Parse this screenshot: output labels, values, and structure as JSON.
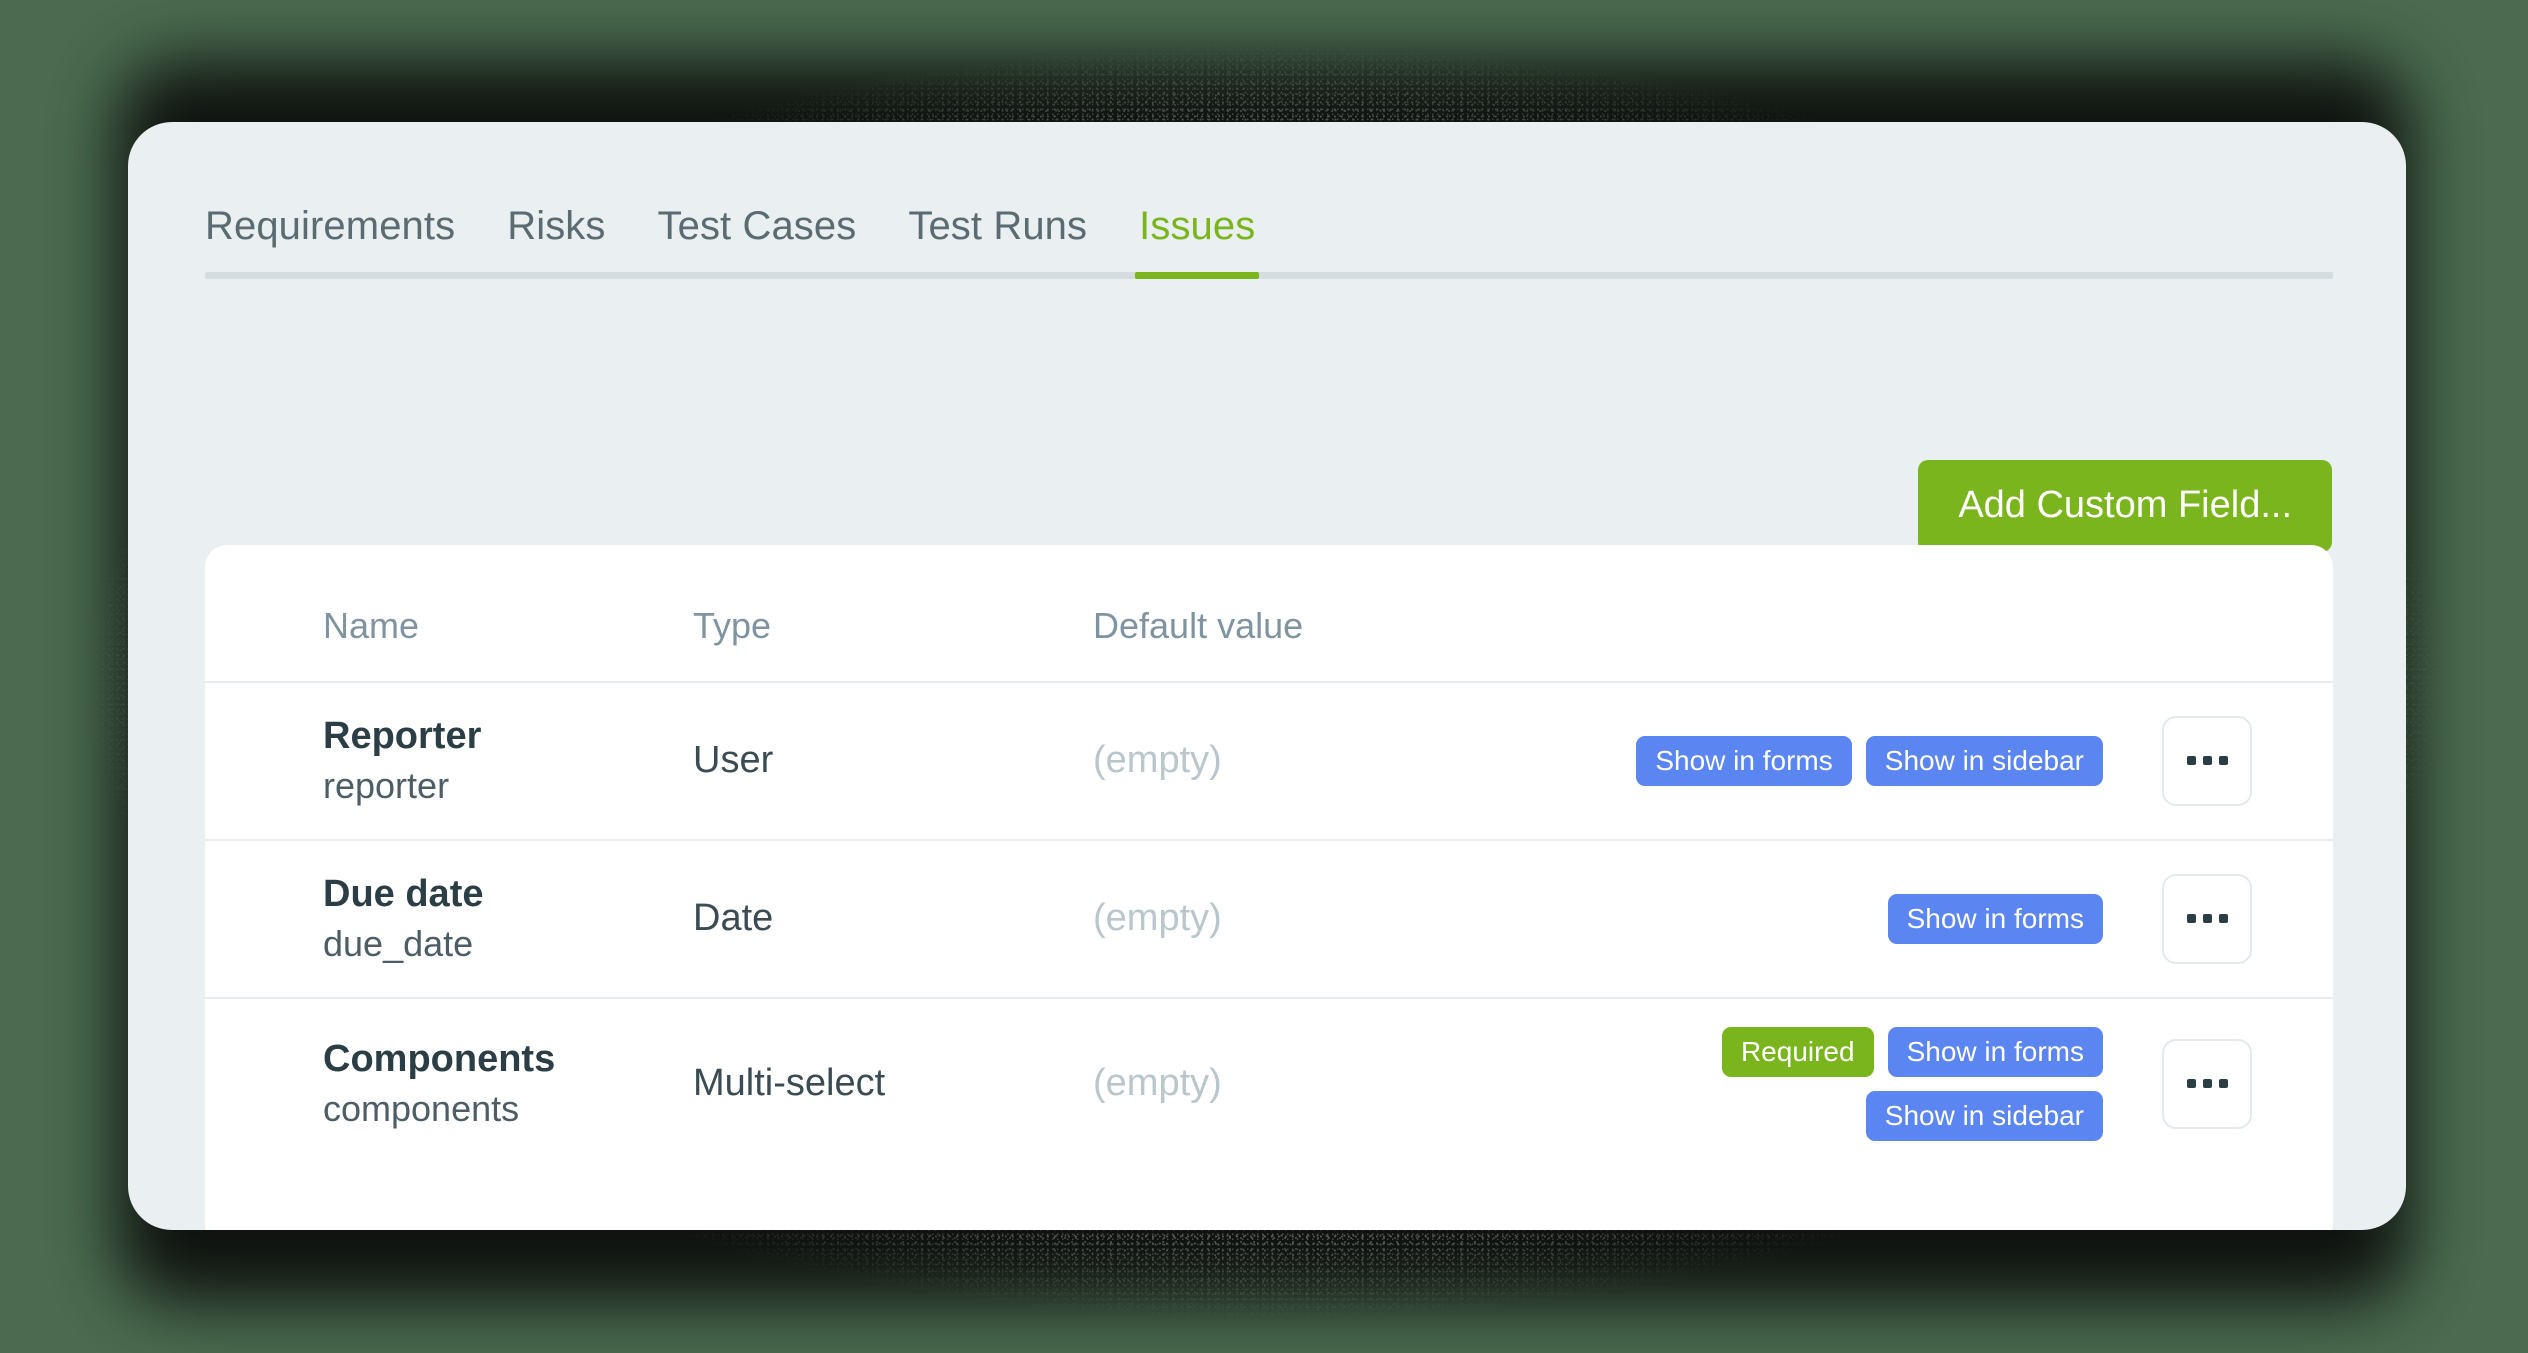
{
  "theme": {
    "backdrop_color": "#4a6b4f",
    "panel_color": "#eaeff1",
    "card_color": "#ffffff",
    "accent_green": "#7ab51d",
    "badge_blue": "#5b85f0",
    "header_text_color": "#7f94a0",
    "tab_text_color": "#5a6b72"
  },
  "tabs": {
    "items": [
      {
        "label": "Requirements",
        "active": false
      },
      {
        "label": "Risks",
        "active": false
      },
      {
        "label": "Test Cases",
        "active": false
      },
      {
        "label": "Test Runs",
        "active": false
      },
      {
        "label": "Issues",
        "active": true
      }
    ]
  },
  "toolbar": {
    "add_field_label": "Add Custom Field..."
  },
  "table": {
    "columns": [
      "Name",
      "Type",
      "Default value"
    ],
    "rows": [
      {
        "name": "Reporter",
        "slug": "reporter",
        "type": "User",
        "default_value": "(empty)",
        "badges": [
          {
            "label": "Show in forms",
            "color": "blue"
          },
          {
            "label": "Show in sidebar",
            "color": "blue"
          }
        ],
        "menu_icon": "ellipsis-icon"
      },
      {
        "name": "Due date",
        "slug": "due_date",
        "type": "Date",
        "default_value": "(empty)",
        "badges": [
          {
            "label": "Show in forms",
            "color": "blue"
          }
        ],
        "menu_icon": "ellipsis-icon"
      },
      {
        "name": "Components",
        "slug": "components",
        "type": "Multi-select",
        "default_value": "(empty)",
        "badges": [
          {
            "label": "Required",
            "color": "green"
          },
          {
            "label": "Show in forms",
            "color": "blue"
          },
          {
            "label": "Show in sidebar",
            "color": "blue"
          }
        ],
        "menu_icon": "ellipsis-icon"
      }
    ]
  }
}
